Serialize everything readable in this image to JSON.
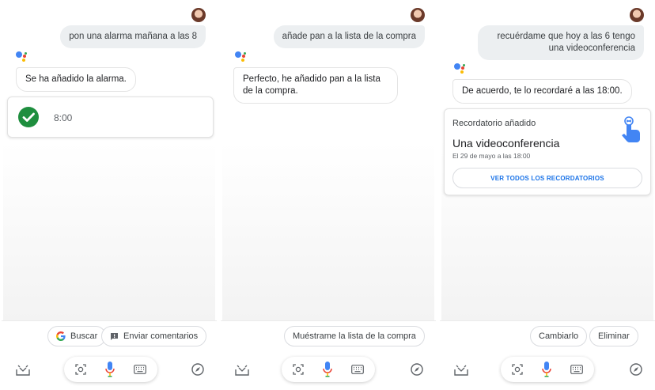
{
  "panels": [
    {
      "user_message": "pon una alarma mañana a las 8",
      "assistant_message": "Se ha añadido la alarma.",
      "alarm_card": {
        "time": "8:00"
      },
      "chips": [
        {
          "label": "Buscar",
          "icon": "google-g-icon"
        },
        {
          "label": "Enviar comentarios",
          "icon": "feedback-icon"
        }
      ]
    },
    {
      "user_message": "añade pan a la lista de la compra",
      "assistant_message": "Perfecto, he añadido pan a la lista de la compra.",
      "chips": [
        {
          "label": "Muéstrame la lista de la compra"
        }
      ]
    },
    {
      "user_message": "recuérdame que hoy a las 6 tengo una videoconferencia",
      "assistant_message": "De acuerdo, te lo recordaré a las 18:00.",
      "reminder_card": {
        "header": "Recordatorio añadido",
        "title": "Una videoconferencia",
        "subtitle": "El 29 de mayo a las 18:00",
        "button": "VER TODOS LOS RECORDATORIOS"
      },
      "chips": [
        {
          "label": "Cambiarlo"
        },
        {
          "label": "Eliminar"
        }
      ]
    }
  ],
  "colors": {
    "google_blue": "#4285f4",
    "google_red": "#ea4335",
    "google_yellow": "#fbbc05",
    "google_green": "#34a853",
    "alarm_check": "#1e8e3e",
    "link_blue": "#1a73e8"
  }
}
